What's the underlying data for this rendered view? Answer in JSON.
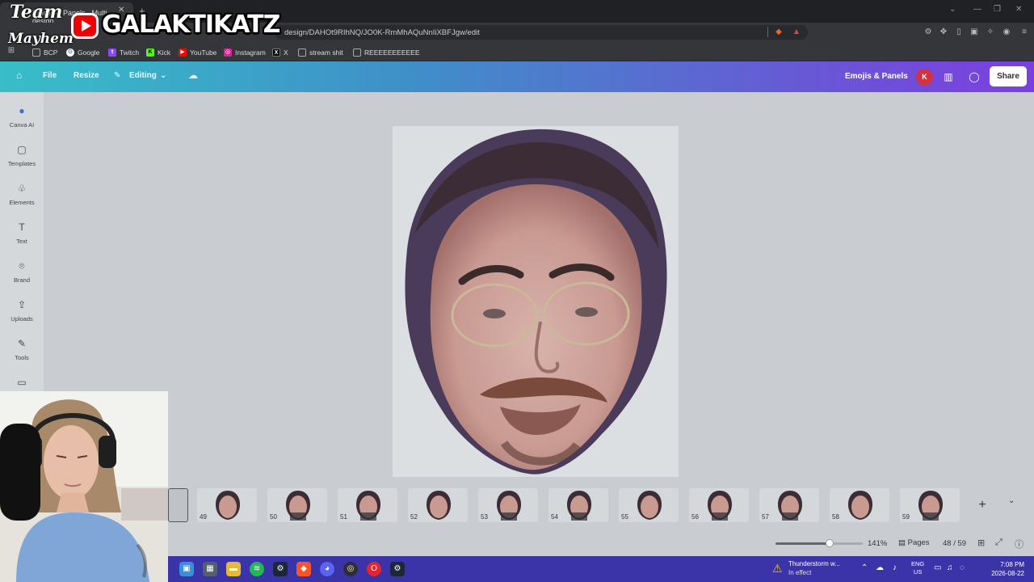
{
  "browser": {
    "tab_title": "Emojis & Panels - Multi-design",
    "url": "design/DAHOt9RIhNQ/JO0K-RmMhAQuNnIiXBFJgw/edit",
    "bookmarks": [
      {
        "label": "BCP",
        "icon": "folder-icon",
        "color": "#888888"
      },
      {
        "label": "Google",
        "icon": "google-icon",
        "color": "#4285f4"
      },
      {
        "label": "Twitch",
        "icon": "twitch-icon",
        "color": "#9146ff"
      },
      {
        "label": "Kick",
        "icon": "kick-icon",
        "color": "#53fc18"
      },
      {
        "label": "YouTube",
        "icon": "youtube-icon",
        "color": "#ff0000"
      },
      {
        "label": "Instagram",
        "icon": "instagram-icon",
        "color": "#d6249f"
      },
      {
        "label": "X",
        "icon": "x-icon",
        "color": "#000000"
      },
      {
        "label": "stream shit",
        "icon": "folder-icon",
        "color": "#888888"
      },
      {
        "label": "REEEEEEEEEEE",
        "icon": "folder-icon",
        "color": "#888888"
      }
    ]
  },
  "overlay": {
    "team_word": "Team",
    "mayhem_word": "Mayhem",
    "channel_name": "GALAKTIKATZ"
  },
  "canva": {
    "menu": {
      "file": "File",
      "resize": "Resize",
      "editing": "Editing"
    },
    "design_title": "Emojis & Panels",
    "avatar_initial": "K",
    "share_label": "Share",
    "sidebar": [
      {
        "label": "Canva AI",
        "icon": "canva-ai-icon"
      },
      {
        "label": "Templates",
        "icon": "templates-icon"
      },
      {
        "label": "Elements",
        "icon": "elements-icon"
      },
      {
        "label": "Text",
        "icon": "text-icon"
      },
      {
        "label": "Brand",
        "icon": "brand-icon"
      },
      {
        "label": "Uploads",
        "icon": "uploads-icon"
      },
      {
        "label": "Tools",
        "icon": "tools-icon"
      }
    ],
    "thumbnails": [
      "49",
      "50",
      "51",
      "52",
      "53",
      "54",
      "55",
      "56",
      "57",
      "58",
      "59"
    ],
    "zoom_label": "141%",
    "zoom_fraction": 0.62,
    "pages_label": "Pages",
    "page_count": "48 / 59"
  },
  "taskbar": {
    "weather_title": "Thunderstorm w...",
    "weather_sub": "In effect",
    "lang_line1": "ENG",
    "lang_line2": "US",
    "time": "7:08 PM",
    "date": "2026-08-22"
  },
  "colors": {
    "header_start": "#38bec8",
    "header_end": "#7b3fe0",
    "taskbar": "#3b33a8",
    "avatar": "#d13440"
  }
}
